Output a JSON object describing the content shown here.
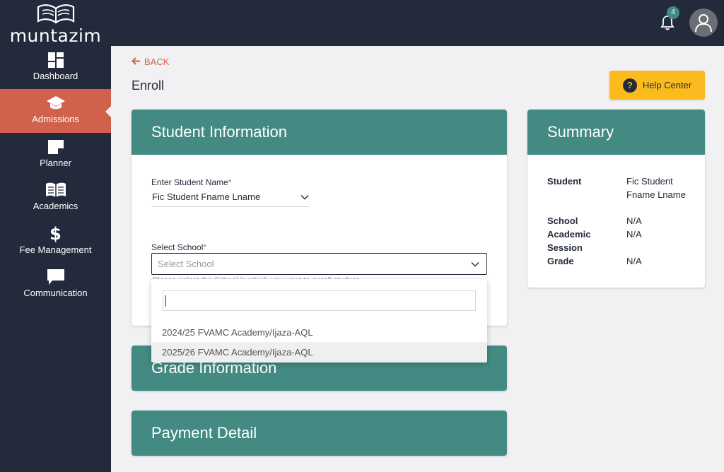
{
  "brand": {
    "name": "muntazim"
  },
  "sidebar": {
    "items": [
      {
        "label": "Dashboard",
        "icon": "dashboard-icon",
        "active": false
      },
      {
        "label": "Admissions",
        "icon": "graduation-cap-icon",
        "active": true
      },
      {
        "label": "Planner",
        "icon": "planner-note-icon",
        "active": false
      },
      {
        "label": "Academics",
        "icon": "open-book-icon",
        "active": false
      },
      {
        "label": "Fee Management",
        "icon": "dollar-icon",
        "active": false
      },
      {
        "label": "Communication",
        "icon": "chat-bubble-icon",
        "active": false
      }
    ]
  },
  "header": {
    "notification_count": "4"
  },
  "page": {
    "back_label": "BACK",
    "title": "Enroll",
    "help_label": "Help Center"
  },
  "student_info": {
    "title": "Student Information",
    "name_label": "Enter Student Name",
    "required_mark": "*",
    "name_value": "Fic Student Fname Lname",
    "school_label": "Select School",
    "school_placeholder": "Select School",
    "helper_text": "Please select the School in which you want to enroll student."
  },
  "grade_info": {
    "title": "Grade Information"
  },
  "payment": {
    "title": "Payment Detail"
  },
  "summary": {
    "title": "Summary",
    "rows": [
      {
        "label": "Student",
        "value": "Fic Student Fname Lname"
      },
      {
        "label": "School",
        "value": "N/A"
      },
      {
        "label": "Academic Session",
        "value": "N/A"
      },
      {
        "label": "Grade",
        "value": "N/A"
      }
    ]
  },
  "dropdown": {
    "search_value": "",
    "options": [
      "2024/25 FVAMC Academy/Ijaza-AQL",
      "2025/26 FVAMC Academy/Ijaza-AQL"
    ]
  },
  "colors": {
    "sidebar_bg": "#232a3b",
    "active_nav": "#d0614d",
    "card_header": "#438a82",
    "help_button": "#fbbb1f",
    "page_bg": "#f1f1f3"
  }
}
